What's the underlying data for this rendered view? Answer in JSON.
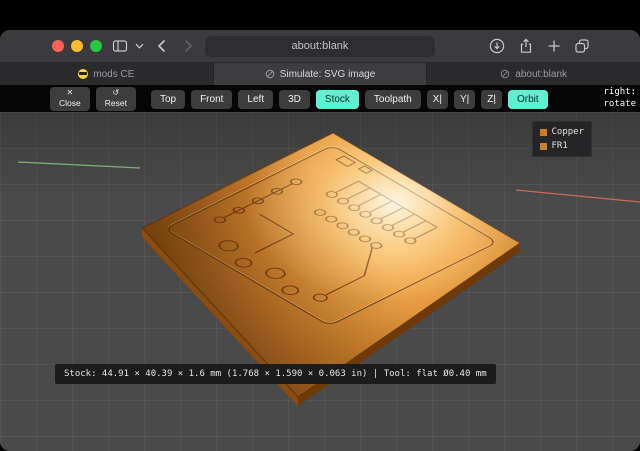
{
  "chrome": {
    "address": "about:blank"
  },
  "tabs": [
    {
      "icon": "😎",
      "label": "mods CE",
      "active": false
    },
    {
      "icon": "globe",
      "label": "Simulate: SVG image",
      "active": true
    },
    {
      "icon": "globe",
      "label": "about:blank",
      "active": false
    }
  ],
  "toolbar": {
    "close_icon": "✕",
    "close_label": "Close",
    "reset_icon": "↺",
    "reset_label": "Reset",
    "views": [
      "Top",
      "Front",
      "Left",
      "3D"
    ],
    "stock": "Stock",
    "toolpath": "Toolpath",
    "axis": [
      "X|",
      "Y|",
      "Z|"
    ],
    "orbit": "Orbit",
    "hint_line1": "right:",
    "hint_line2": "rotate"
  },
  "legend": {
    "items": [
      {
        "label": "Copper",
        "color": "#d2791e",
        "swatch": "background:#d2791e"
      },
      {
        "label": "FR1",
        "color": "#c9812c",
        "swatch": "background:#c9812c"
      }
    ]
  },
  "status": "Stock: 44.91 × 40.39 × 1.6 mm (1.768 × 1.590 × 0.063 in) | Tool: flat Ø0.40 mm",
  "colors": {
    "accent": "#5ef0d0",
    "copper_bright": "#ffdf9e",
    "copper_dark": "#a05a14",
    "grid_bg": "#4a4a4b"
  }
}
